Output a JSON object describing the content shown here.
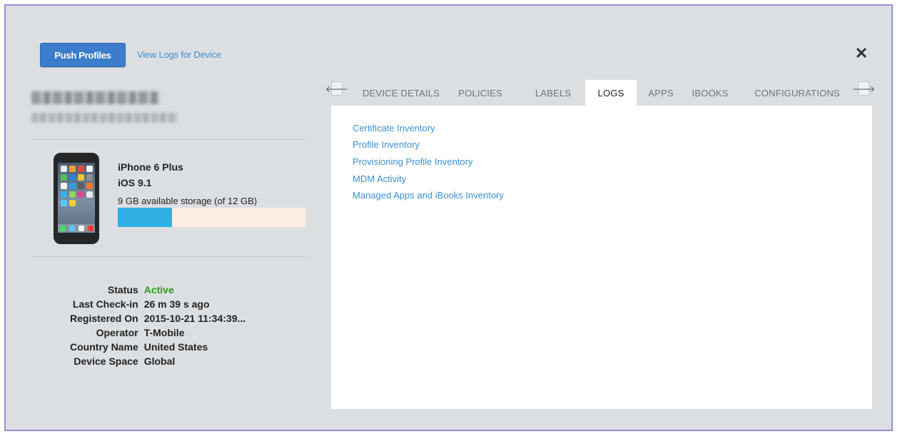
{
  "header": {
    "push_profiles_label": "Push Profiles",
    "view_logs_label": "View Logs for Device",
    "close_symbol": "✕"
  },
  "device": {
    "model": "iPhone 6 Plus",
    "os": "iOS 9.1",
    "storage_text": "9 GB available storage (of 12 GB)",
    "storage_used_fraction": 0.29
  },
  "info": {
    "status_label": "Status",
    "status_value": "Active",
    "last_checkin_label": "Last Check-in",
    "last_checkin_value": "26 m 39 s ago",
    "registered_label": "Registered On",
    "registered_value": "2015-10-21 11:34:39...",
    "operator_label": "Operator",
    "operator_value": "T-Mobile",
    "country_label": "Country Name",
    "country_value": "United States",
    "space_label": "Device Space",
    "space_value": "Global"
  },
  "tabs": {
    "left_arrow": "🡐",
    "right_arrow": "🡒",
    "items": [
      "DEVICE DETAILS",
      "POLICIES",
      "LABELS",
      "LOGS",
      "APPS",
      "IBOOKS",
      "CONFIGURATIONS"
    ],
    "active": "LOGS"
  },
  "logs": {
    "links": [
      "Certificate Inventory",
      "Profile Inventory",
      "Provisioning Profile Inventory",
      "MDM Activity",
      "Managed Apps and iBooks Inventory"
    ]
  },
  "colors": {
    "primary_button": "#3b7ccb",
    "link": "#3c8fd6",
    "status_active": "#2f9a1b",
    "storage_fill": "#2fb0e4",
    "storage_track": "#fbede3",
    "modal_background": "#dcdfe2"
  }
}
